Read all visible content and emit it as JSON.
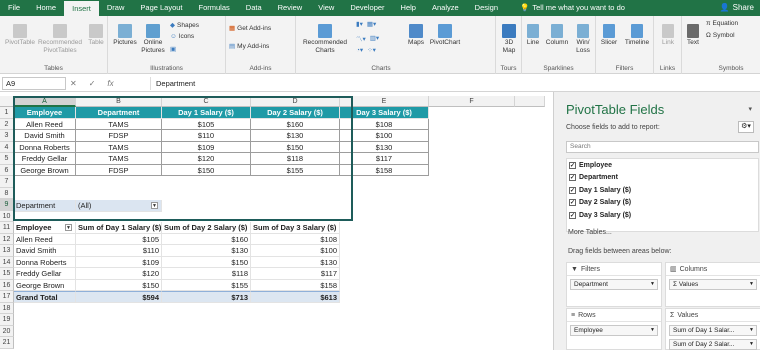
{
  "menu": {
    "tabs": [
      "File",
      "Home",
      "Insert",
      "Draw",
      "Page Layout",
      "Formulas",
      "Data",
      "Review",
      "View",
      "Developer",
      "Help",
      "Analyze",
      "Design"
    ],
    "active": "Insert",
    "tell_me": "Tell me what you want to do",
    "share": "Share"
  },
  "ribbon": {
    "groups": {
      "tables": "Tables",
      "illustrations": "Illustrations",
      "addins": "Add-ins",
      "charts": "Charts",
      "tours": "Tours",
      "sparklines": "Sparklines",
      "filters": "Filters",
      "links": "Links",
      "symbols": "Symbols"
    },
    "pivot_table": "PivotTable",
    "recommended_pivot": "Recommended PivotTables",
    "table": "Table",
    "pictures": "Pictures",
    "online_pictures": "Online Pictures",
    "shapes": "Shapes",
    "icons": "Icons",
    "get_addins": "Get Add-ins",
    "my_addins": "My Add-ins",
    "recommended_charts": "Recommended Charts",
    "maps": "Maps",
    "pivot_chart": "PivotChart",
    "map3d": "3D Map",
    "line": "Line",
    "column": "Column",
    "winloss": "Win/ Loss",
    "slicer": "Slicer",
    "timeline": "Timeline",
    "link": "Link",
    "text": "Text",
    "equation": "Equation",
    "symbol": "Symbol"
  },
  "formula_bar": {
    "name_box": "A9",
    "content": "Department",
    "fx": "fx",
    "cancel": "✕",
    "enter": "✓"
  },
  "sheet": {
    "columns": [
      "A",
      "B",
      "C",
      "D",
      "E",
      "F"
    ],
    "rows": [
      "1",
      "2",
      "3",
      "4",
      "5",
      "6",
      "7",
      "8",
      "9",
      "10",
      "11",
      "12",
      "13",
      "14",
      "15",
      "16",
      "17",
      "18",
      "19",
      "20",
      "21"
    ],
    "source_headers": [
      "Employee",
      "Department",
      "Day 1 Salary ($)",
      "Day 2 Salary ($)",
      "Day 3 Salary ($)"
    ],
    "source_rows": [
      [
        "Allen Reed",
        "TAMS",
        "$105",
        "$160",
        "$108"
      ],
      [
        "David Smith",
        "FDSP",
        "$110",
        "$130",
        "$100"
      ],
      [
        "Donna Roberts",
        "TAMS",
        "$109",
        "$150",
        "$130"
      ],
      [
        "Freddy Gellar",
        "TAMS",
        "$120",
        "$118",
        "$117"
      ],
      [
        "George Brown",
        "FDSP",
        "$150",
        "$155",
        "$158"
      ]
    ],
    "filter_label": "Department",
    "filter_value": "(All)",
    "pivot_headers": [
      "Employee",
      "Sum of Day 1 Salary ($)",
      "Sum of Day 2 Salary ($)",
      "Sum of Day 3 Salary ($)"
    ],
    "pivot_rows": [
      [
        "Allen Reed",
        "$105",
        "$160",
        "$108"
      ],
      [
        "David Smith",
        "$110",
        "$130",
        "$100"
      ],
      [
        "Donna Roberts",
        "$109",
        "$150",
        "$130"
      ],
      [
        "Freddy Gellar",
        "$120",
        "$118",
        "$117"
      ],
      [
        "George Brown",
        "$150",
        "$155",
        "$158"
      ]
    ],
    "grand_total": [
      "Grand Total",
      "$594",
      "$713",
      "$613"
    ]
  },
  "pivot_pane": {
    "title": "PivotTable Fields",
    "subtitle": "Choose fields to add to report:",
    "search_placeholder": "Search",
    "fields": [
      "Employee",
      "Department",
      "Day 1 Salary ($)",
      "Day 2 Salary ($)",
      "Day 3 Salary ($)"
    ],
    "more_tables": "More Tables...",
    "drag_label": "Drag fields between areas below:",
    "areas": {
      "filters": {
        "title": "Filters",
        "chips": [
          "Department"
        ]
      },
      "columns": {
        "title": "Columns",
        "chips": [
          "Σ Values"
        ]
      },
      "rows": {
        "title": "Rows",
        "chips": [
          "Employee"
        ]
      },
      "values": {
        "title": "Values",
        "chips": [
          "Sum of Day 1 Salar...",
          "Sum of Day 2 Salar..."
        ]
      }
    }
  },
  "colors": {
    "accent": "#217346",
    "table_header": "#1f9aa6",
    "grand_total": "#dce6f1"
  }
}
